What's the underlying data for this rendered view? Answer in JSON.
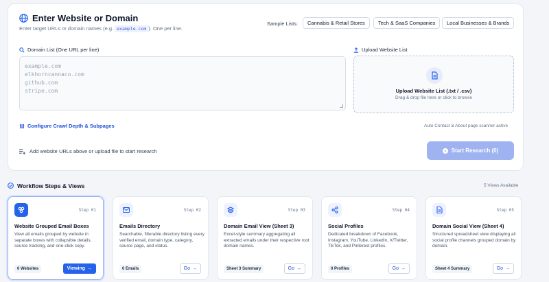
{
  "panel": {
    "title": "Enter Website or Domain",
    "subtitle_before": "Enter target URLs or domain names (e.g. ",
    "subtitle_code": "example.com",
    "subtitle_after": "). One per line.",
    "sample_label": "Sample Lists:",
    "samples": [
      "Cannabis & Retail Stores",
      "Tech & SaaS Companies",
      "Local Businesses & Brands"
    ]
  },
  "domain_list": {
    "label": "Domain List (One URL per line)",
    "placeholder_lines": [
      "example.com",
      "elkhorncannaco.com",
      "github.com",
      "stripe.com"
    ]
  },
  "upload": {
    "label": "Upload Website List",
    "title": "Upload Website List (.txt / .csv)",
    "subtitle": "Drag & drop file here or click to browse"
  },
  "crawl_link": "Configure Crawl Depth & Subpages",
  "scanner_note": "Auto Contact & About page scanner active",
  "hint": "Add website URLs above or upload file to start research",
  "start_button": "Start Research (0)",
  "workflow": {
    "title": "Workflow Steps & Views",
    "count": "5 Views Available",
    "cards": [
      {
        "step": "Step 01",
        "title": "Website Grouped Email Boxes",
        "desc": "View all emails grouped by website in separate boxes with collapsible details, source tracking, and one-click copy.",
        "badge": "0 Websites",
        "button": "Viewing",
        "icon": "grid-icon"
      },
      {
        "step": "Step 02",
        "title": "Emails Directory",
        "desc": "Searchable, filterable directory listing every verified email, domain type, category, source page, and status.",
        "badge": "0 Emails",
        "button": "Go",
        "icon": "mail-icon"
      },
      {
        "step": "Step 03",
        "title": "Domain Email View (Sheet 3)",
        "desc": "Excel-style summary aggregating all extracted emails under their respective root domain names.",
        "badge": "Sheet 3 Summary",
        "button": "Go",
        "icon": "layers-icon"
      },
      {
        "step": "Step 04",
        "title": "Social Profiles",
        "desc": "Dedicated breakdown of Facebook, Instagram, YouTube, LinkedIn, X/Twitter, TikTok, and Pinterest profiles.",
        "badge": "0 Profiles",
        "button": "Go",
        "icon": "share-icon"
      },
      {
        "step": "Step 05",
        "title": "Domain Social View (Sheet 4)",
        "desc": "Structured spreadsheet view displaying all social profile channels grouped domain by domain.",
        "badge": "Sheet 4 Summary",
        "button": "Go",
        "icon": "document-icon"
      }
    ]
  },
  "colors": {
    "accent": "#2563eb",
    "accent_disabled": "#9fb3f0",
    "background": "#f3f5f9"
  }
}
